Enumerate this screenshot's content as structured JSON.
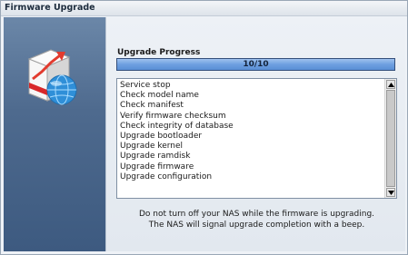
{
  "window": {
    "title": "Firmware Upgrade"
  },
  "progress": {
    "label": "Upgrade Progress",
    "text": "10/10",
    "fraction": 1.0
  },
  "log": {
    "items": [
      "Service stop",
      "Check model name",
      "Check manifest",
      "Verify firmware checksum",
      "Check integrity of database",
      "Upgrade bootloader",
      "Upgrade kernel",
      "Upgrade ramdisk",
      "Upgrade firmware",
      "Upgrade configuration"
    ]
  },
  "notes": {
    "line1": "Do not turn off your NAS while the firmware is upgrading.",
    "line2": "The NAS will signal upgrade completion with a beep."
  },
  "icons": {
    "app": "firmware-upgrade-icon",
    "scroll_up": "arrow-up-icon",
    "scroll_down": "arrow-down-icon"
  },
  "colors": {
    "progress_fill": "#6e9fe0",
    "panel": "#4e6a8e"
  }
}
